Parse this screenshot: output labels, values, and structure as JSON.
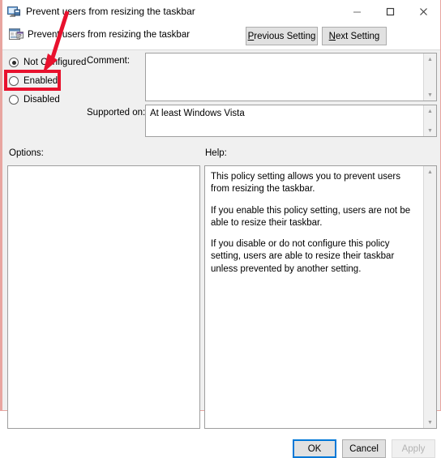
{
  "window": {
    "title": "Prevent users from resizing the taskbar",
    "title_icon": "monitor-policy-icon",
    "minimize_icon": "minimize-icon",
    "maximize_icon": "maximize-icon",
    "close_icon": "close-icon"
  },
  "header": {
    "icon": "taskbar-policy-icon",
    "title": "Prevent users from resizing the taskbar",
    "previous_button": "Previous Setting",
    "previous_accel": "P",
    "next_button": "Next Setting",
    "next_accel": "N"
  },
  "state": {
    "options": [
      {
        "label": "Not Configured",
        "selected": true
      },
      {
        "label": "Enabled",
        "selected": false
      },
      {
        "label": "Disabled",
        "selected": false
      }
    ]
  },
  "comment": {
    "label": "Comment:",
    "value": "",
    "placeholder": ""
  },
  "supported": {
    "label": "Supported on:",
    "value": "At least Windows Vista"
  },
  "sections": {
    "options_label": "Options:",
    "help_label": "Help:"
  },
  "options_panel": {
    "content": ""
  },
  "help": {
    "paragraphs": [
      "This policy setting allows you to prevent users from resizing the taskbar.",
      "If you enable this policy setting, users are not be able to resize their taskbar.",
      "If you disable or do not configure this policy setting, users are able to resize their taskbar unless prevented by another setting."
    ]
  },
  "footer": {
    "ok": "OK",
    "cancel": "Cancel",
    "apply": "Apply",
    "apply_disabled": true
  },
  "annotation": {
    "color": "#e8112d",
    "highlight_target": "Enabled",
    "shapes": [
      "rectangle",
      "arrow"
    ]
  },
  "scrollbars": {
    "up_arrow": "▲",
    "down_arrow": "▼"
  }
}
